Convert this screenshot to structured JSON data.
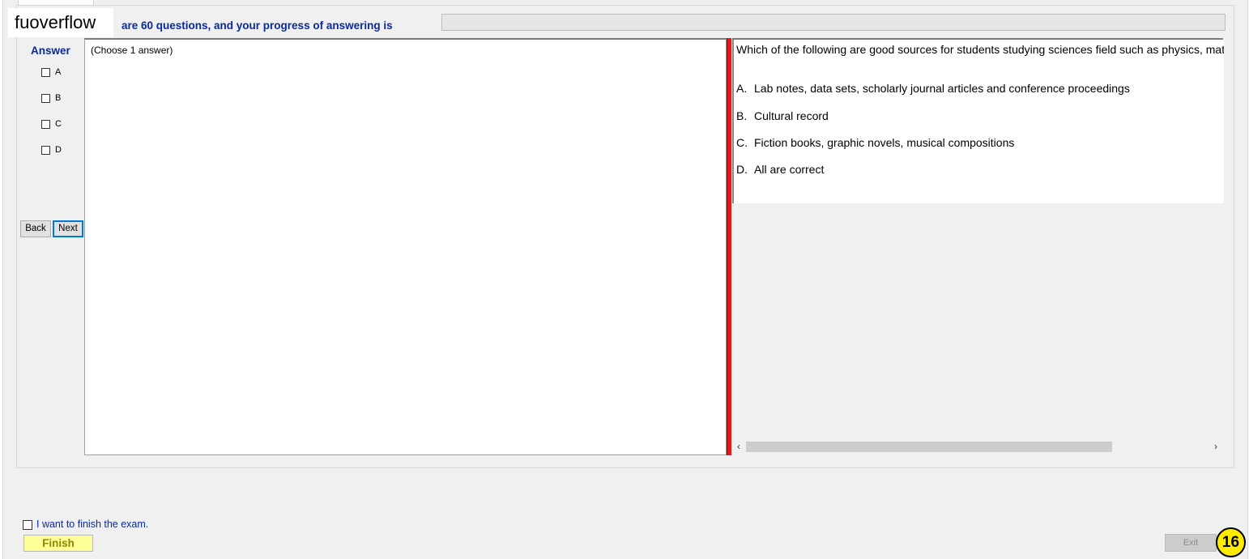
{
  "watermark": "fuoverflow",
  "progress": {
    "text": "are 60 questions, and your progress of answering is",
    "value": 0
  },
  "answer": {
    "title": "Answer",
    "options": [
      "A",
      "B",
      "C",
      "D"
    ]
  },
  "nav": {
    "back_label": "Back",
    "next_label": "Next"
  },
  "left_pane": {
    "note": "(Choose 1 answer)"
  },
  "question": {
    "text": "Which of the following are good sources for students studying sciences field such as physics, math?",
    "options": [
      {
        "letter": "A.",
        "text": "Lab notes, data sets, scholarly journal articles and conference proceedings"
      },
      {
        "letter": "B.",
        "text": "Cultural record"
      },
      {
        "letter": "C.",
        "text": "Fiction books, graphic novels, musical compositions"
      },
      {
        "letter": "D.",
        "text": "All are correct"
      }
    ]
  },
  "scrollbar": {
    "left_arrow": "‹",
    "right_arrow": "›"
  },
  "footer": {
    "finish_check_label": "I want to finish the exam.",
    "finish_label": "Finish",
    "exit_label": "Exit",
    "badge": "16"
  },
  "colors": {
    "accent_text": "#0a2a9c",
    "splitter": "#e21b1b",
    "finish_bg": "#ffff99",
    "badge_bg": "#ffeb00"
  }
}
